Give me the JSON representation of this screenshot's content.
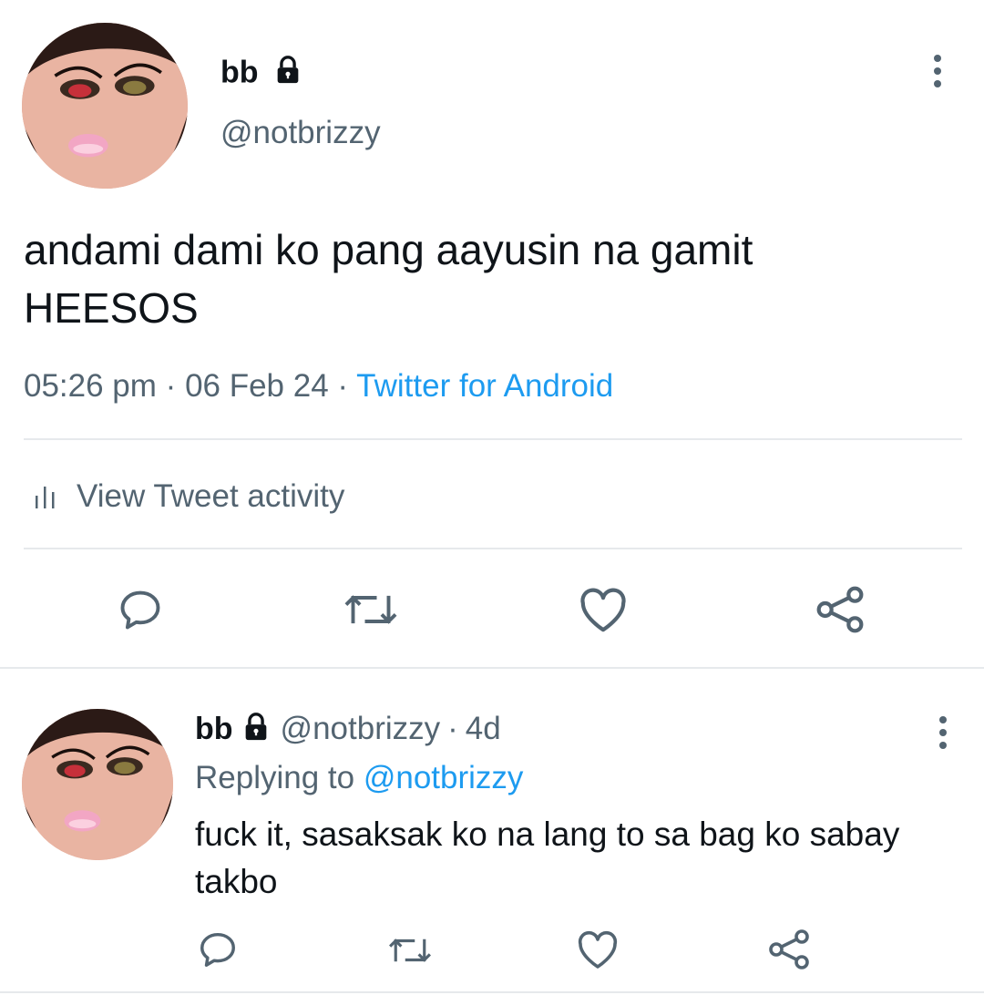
{
  "tweet": {
    "display_name": "bb",
    "handle": "@notbrizzy",
    "text": "andami dami ko pang aayusin na gamit HEESOS",
    "time": "05:26 pm",
    "separator": "·",
    "date": "06 Feb 24",
    "source": "Twitter for Android",
    "activity_label": "View Tweet activity"
  },
  "reply": {
    "display_name": "bb",
    "handle": "@notbrizzy",
    "separator": "·",
    "age": "4d",
    "replying_prefix": "Replying to",
    "replying_handle": "@notbrizzy",
    "text": "fuck it, sasaksak ko na lang to sa bag ko sabay takbo"
  },
  "colors": {
    "text": "#0f1419",
    "secondary": "#536471",
    "link": "#1d9bf0",
    "divider": "#e6e9ec"
  },
  "icons": [
    "lock-icon",
    "more-icon",
    "activity-icon",
    "reply-icon",
    "retweet-icon",
    "like-icon",
    "share-icon"
  ]
}
